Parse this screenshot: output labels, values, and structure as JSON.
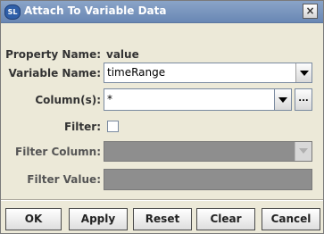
{
  "window": {
    "title": "Attach To Variable Data",
    "logo_text": "SL",
    "close_label": "×"
  },
  "form": {
    "property_name_label": "Property Name:",
    "property_name_value": "value",
    "variable_name_label": "Variable Name:",
    "variable_name_value": "timeRange",
    "columns_label": "Column(s):",
    "columns_value": "*",
    "columns_browse_label": "...",
    "filter_label": "Filter:",
    "filter_checked": false,
    "filter_column_label": "Filter Column:",
    "filter_column_value": "",
    "filter_value_label": "Filter Value:",
    "filter_value_value": ""
  },
  "buttons": {
    "ok": "OK",
    "apply": "Apply",
    "reset": "Reset",
    "clear": "Clear",
    "cancel": "Cancel"
  }
}
